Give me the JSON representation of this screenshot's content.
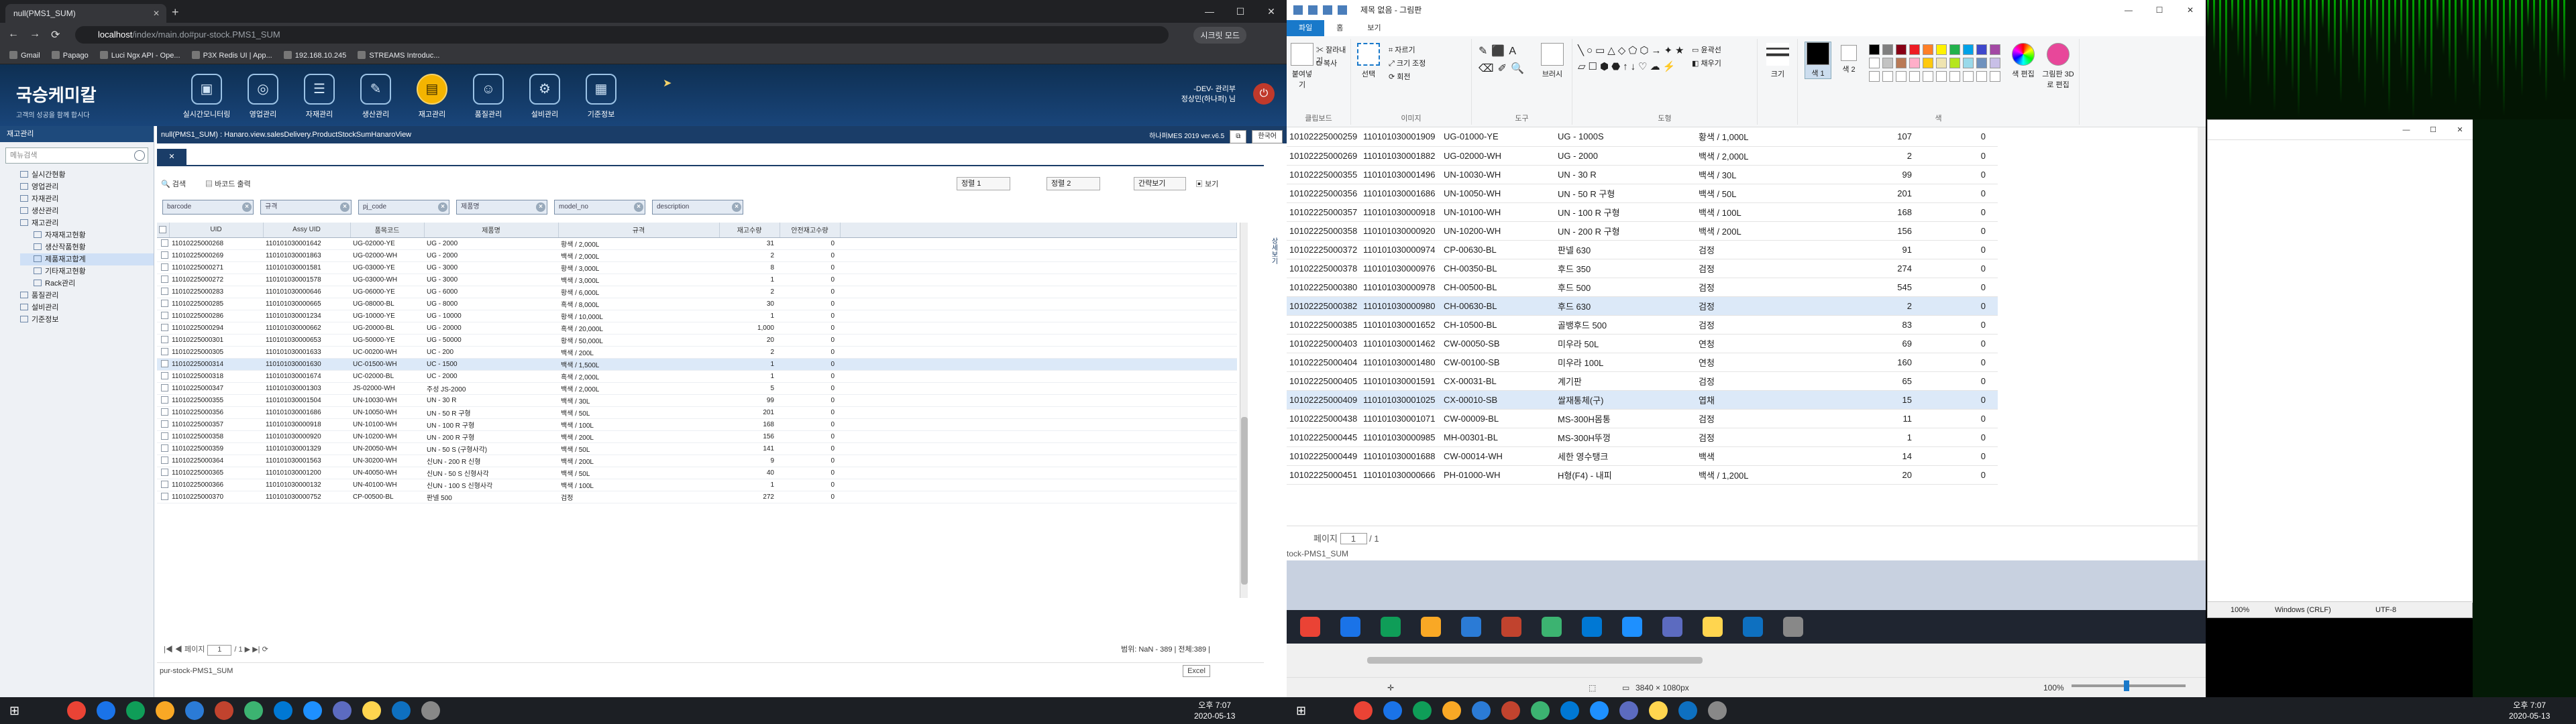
{
  "browser": {
    "tab_title": "null(PMS1_SUM)",
    "url_host": "localhost",
    "url_path": "/index/main.do#pur-stock.PMS1_SUM",
    "incognito_label": "시크릿 모드",
    "bookmarks": [
      "Gmail",
      "Papago",
      "Luci Ngx API - Ope...",
      "P3X Redis UI | App...",
      "192.168.10.245",
      "STREAMS Introduc..."
    ]
  },
  "app": {
    "company": "국승케미칼",
    "tagline": "고객의 성공을 함께 합시다",
    "menus": [
      "실시간모니터링",
      "영업관리",
      "자재관리",
      "생산관리",
      "재고관리",
      "품질관리",
      "설비관리",
      "기준정보"
    ],
    "active_menu": "재고관리",
    "user_line1": "-DEV- 관리부",
    "user_line2": "정상민(하나퍼) 님",
    "left_header": "재고관리",
    "left_search_placeholder": "메뉴검색",
    "tree": [
      {
        "label": "실시간현황",
        "level": 0
      },
      {
        "label": "영업관리",
        "level": 0
      },
      {
        "label": "자재관리",
        "level": 0
      },
      {
        "label": "생산관리",
        "level": 0
      },
      {
        "label": "재고관리",
        "level": 0
      },
      {
        "label": "자재재고현황",
        "level": 1
      },
      {
        "label": "생산작품현황",
        "level": 1
      },
      {
        "label": "제품재고합계",
        "level": 1,
        "selected": true
      },
      {
        "label": "기타재고현황",
        "level": 1
      },
      {
        "label": "Rack관리",
        "level": 1
      },
      {
        "label": "품질관리",
        "level": 0
      },
      {
        "label": "설비관리",
        "level": 0
      },
      {
        "label": "기준정보",
        "level": 0
      }
    ],
    "breadcrumb": "null(PMS1_SUM) : Hanaro.view.salesDelivery.ProductStockSumHanaroView",
    "breadcrumb_right": "하나퍼MES 2019 ver.v6.5",
    "lang": "한국어",
    "toolbar": {
      "search": "검색",
      "excel": "바코드 출력",
      "sort1": "정렬 1",
      "sort2": "정렬 2",
      "density": "간략보기",
      "view": "보기"
    },
    "filters": [
      "barcode",
      "규격",
      "pj_code",
      "제품명",
      "model_no",
      "description"
    ],
    "columns": [
      "UID",
      "Assy UID",
      "품목코드",
      "제품명",
      "규격",
      "재고수량",
      "안전재고수량"
    ],
    "rows": [
      [
        "11010225000268",
        "110101030001642",
        "UG-02000-YE",
        "UG - 2000",
        "황색 / 2,000L",
        "31",
        "0"
      ],
      [
        "11010225000269",
        "110101030001863",
        "UG-02000-WH",
        "UG - 2000",
        "백색 / 2,000L",
        "2",
        "0"
      ],
      [
        "11010225000271",
        "110101030001581",
        "UG-03000-YE",
        "UG - 3000",
        "황색 / 3,000L",
        "8",
        "0"
      ],
      [
        "11010225000272",
        "110101030001578",
        "UG-03000-WH",
        "UG - 3000",
        "백색 / 3,000L",
        "1",
        "0"
      ],
      [
        "11010225000283",
        "110101030000646",
        "UG-06000-YE",
        "UG - 6000",
        "황색 / 6,000L",
        "2",
        "0"
      ],
      [
        "11010225000285",
        "110101030000665",
        "UG-08000-BL",
        "UG - 8000",
        "흑색 / 8,000L",
        "30",
        "0"
      ],
      [
        "11010225000286",
        "110101030001234",
        "UG-10000-YE",
        "UG - 10000",
        "황색 / 10,000L",
        "1",
        "0"
      ],
      [
        "11010225000294",
        "110101030000662",
        "UG-20000-BL",
        "UG - 20000",
        "흑색 / 20,000L",
        "1,000",
        "0"
      ],
      [
        "11010225000301",
        "110101030000653",
        "UG-50000-YE",
        "UG - 50000",
        "황색 / 50,000L",
        "20",
        "0"
      ],
      [
        "11010225000305",
        "110101030001633",
        "UC-00200-WH",
        "UC - 200",
        "백색 / 200L",
        "2",
        "0"
      ],
      [
        "11010225000314",
        "110101030001630",
        "UC-01500-WH",
        "UC - 1500",
        "백색 / 1,500L",
        "1",
        "0"
      ],
      [
        "11010225000318",
        "110101030001674",
        "UC-02000-BL",
        "UC - 2000",
        "흑색 / 2,000L",
        "1",
        "0"
      ],
      [
        "11010225000347",
        "110101030001303",
        "JS-02000-WH",
        "주성 JS-2000",
        "백색 / 2,000L",
        "5",
        "0"
      ],
      [
        "11010225000355",
        "110101030001504",
        "UN-10030-WH",
        "UN - 30 R",
        "백색 / 30L",
        "99",
        "0"
      ],
      [
        "11010225000356",
        "110101030001686",
        "UN-10050-WH",
        "UN - 50 R 구형",
        "백색 / 50L",
        "201",
        "0"
      ],
      [
        "11010225000357",
        "110101030000918",
        "UN-10100-WH",
        "UN - 100 R 구형",
        "백색 / 100L",
        "168",
        "0"
      ],
      [
        "11010225000358",
        "110101030000920",
        "UN-10200-WH",
        "UN - 200 R 구형",
        "백색 / 200L",
        "156",
        "0"
      ],
      [
        "11010225000359",
        "110101030001329",
        "UN-20050-WH",
        "UN - 50 S (구형사각)",
        "백색 / 50L",
        "141",
        "0"
      ],
      [
        "11010225000364",
        "110101030001563",
        "UN-30200-WH",
        "신UN - 200 R 신형",
        "백색 / 200L",
        "9",
        "0"
      ],
      [
        "11010225000365",
        "110101030001200",
        "UN-40050-WH",
        "신UN - 50 S 신형사각",
        "백색 / 50L",
        "40",
        "0"
      ],
      [
        "11010225000366",
        "110101030000132",
        "UN-40100-WH",
        "신UN - 100 S 신형사각",
        "백색 / 100L",
        "1",
        "0"
      ],
      [
        "11010225000370",
        "110101030000752",
        "CP-00500-BL",
        "판넬 500",
        "검정",
        "272",
        "0"
      ]
    ],
    "pager_label": "페이지",
    "pager_value": "1",
    "pager_total": "/ 1",
    "record_count": "범위: NaN - 389 | 전체:389 |",
    "footer_left": "pur-stock-PMS1_SUM",
    "excel_btn": "Excel",
    "side_tab": "상세보기"
  },
  "paint": {
    "title": "제목 없음 - 그림판",
    "tabs": [
      "파일",
      "홈",
      "보기"
    ],
    "groups": [
      "클립보드",
      "이미지",
      "도구",
      "도형",
      "색"
    ],
    "clip": {
      "paste": "붙여넣기",
      "cut": "잘라내기",
      "copy": "복사"
    },
    "image": {
      "select": "선택",
      "crop": "자르기",
      "resize": "크기 조정",
      "rotate": "회전"
    },
    "brush": "브러시",
    "outline": "윤곽선",
    "fill": "채우기",
    "size": "크기",
    "color1": "색 1",
    "color2": "색 2",
    "edit_colors": "색 편집",
    "paint3d": "그림판 3D로 편집",
    "rows": [
      [
        "10102225000259",
        "110101030001909",
        "UG-01000-YE",
        "UG - 1000S",
        "황색 / 1,000L",
        "107",
        "0"
      ],
      [
        "10102225000269",
        "110101030001882",
        "UG-02000-WH",
        "UG - 2000",
        "백색 / 2,000L",
        "2",
        "0"
      ],
      [
        "10102225000355",
        "110101030001496",
        "UN-10030-WH",
        "UN - 30 R",
        "백색 / 30L",
        "99",
        "0"
      ],
      [
        "10102225000356",
        "110101030001686",
        "UN-10050-WH",
        "UN - 50 R 구형",
        "백색 / 50L",
        "201",
        "0"
      ],
      [
        "10102225000357",
        "110101030000918",
        "UN-10100-WH",
        "UN - 100 R 구형",
        "백색 / 100L",
        "168",
        "0"
      ],
      [
        "10102225000358",
        "110101030000920",
        "UN-10200-WH",
        "UN - 200 R 구형",
        "백색 / 200L",
        "156",
        "0"
      ],
      [
        "10102225000372",
        "110101030000974",
        "CP-00630-BL",
        "판넬 630",
        "검정",
        "91",
        "0"
      ],
      [
        "10102225000378",
        "110101030000976",
        "CH-00350-BL",
        "후드 350",
        "검정",
        "274",
        "0"
      ],
      [
        "10102225000380",
        "110101030000978",
        "CH-00500-BL",
        "후드 500",
        "검정",
        "545",
        "0"
      ],
      [
        "10102225000382",
        "110101030000980",
        "CH-00630-BL",
        "후드 630",
        "검정",
        "2",
        "0"
      ],
      [
        "10102225000385",
        "110101030001652",
        "CH-10500-BL",
        "골뱅후드 500",
        "검정",
        "83",
        "0"
      ],
      [
        "10102225000403",
        "110101030001462",
        "CW-00050-SB",
        "미우라 50L",
        "연청",
        "69",
        "0"
      ],
      [
        "10102225000404",
        "110101030001480",
        "CW-00100-SB",
        "미우라 100L",
        "연청",
        "160",
        "0"
      ],
      [
        "10102225000405",
        "110101030001591",
        "CX-00031-BL",
        "계기판",
        "검정",
        "65",
        "0"
      ],
      [
        "10102225000409",
        "110101030001025",
        "CX-00010-SB",
        "쌀재통체(구)",
        "엽채",
        "15",
        "0"
      ],
      [
        "10102225000438",
        "110101030001071",
        "CW-00009-BL",
        "MS-300H몸통",
        "검정",
        "11",
        "0"
      ],
      [
        "10102225000445",
        "110101030000985",
        "MH-00301-BL",
        "MS-300H뚜껑",
        "검정",
        "1",
        "0"
      ],
      [
        "10102225000449",
        "110101030001688",
        "CW-00014-WH",
        "세한 영수탱크",
        "백색",
        "14",
        "0"
      ],
      [
        "10102225000451",
        "110101030000666",
        "PH-01000-WH",
        "H형(F4) - 내피",
        "백색 / 1,200L",
        "20",
        "0"
      ]
    ],
    "page_label": "페이지",
    "page_value": "1",
    "page_total": "/ 1",
    "footer_text": "tock-PMS1_SUM",
    "status_dims": "3840 × 1080px",
    "zoom": "100%"
  },
  "notepad": {
    "zoom": "100%",
    "eol": "Windows (CRLF)",
    "enc": "UTF-8"
  },
  "taskbar": {
    "time_left": "오후 7:07",
    "date_left": "2020-05-13",
    "time_right": "오후 7:07",
    "date_right": "2020-05-13"
  },
  "colors": {
    "brand_dark": "#1a3d68",
    "active_menu": "#f4b400",
    "paint_tab": "#1979ca"
  }
}
